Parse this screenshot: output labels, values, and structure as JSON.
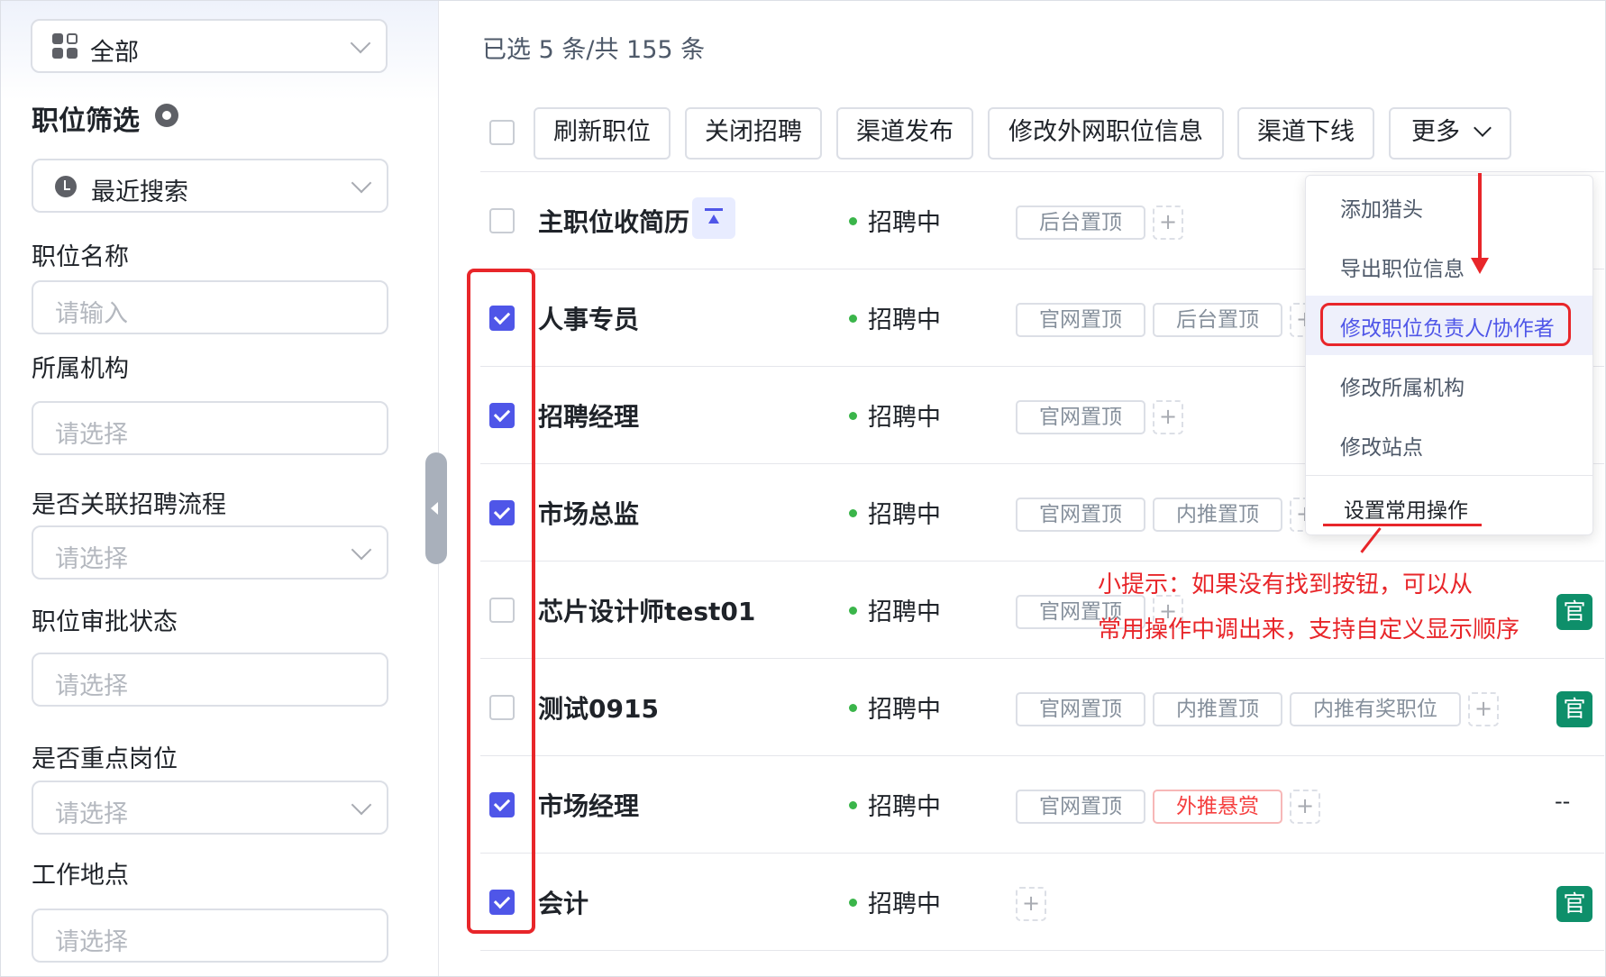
{
  "sidebar": {
    "scope_select": "全部",
    "heading": "职位筛选",
    "recent_search": "最近搜索",
    "filters": [
      {
        "label": "职位名称",
        "placeholder": "请输入"
      },
      {
        "label": "所属机构",
        "placeholder": "请选择"
      },
      {
        "label": "是否关联招聘流程",
        "placeholder": "请选择"
      },
      {
        "label": "职位审批状态",
        "placeholder": "请选择"
      },
      {
        "label": "是否重点岗位",
        "placeholder": "请选择"
      },
      {
        "label": "工作地点",
        "placeholder": "请选择"
      }
    ]
  },
  "main": {
    "selection_count": "已选 5 条/共 155 条",
    "toolbar": [
      "刷新职位",
      "关闭招聘",
      "渠道发布",
      "修改外网职位信息",
      "渠道下线",
      "更多"
    ],
    "rows": [
      {
        "name": "主职位收简历",
        "status": "招聘中",
        "checked": false,
        "tags": [
          "后台置顶"
        ]
      },
      {
        "name": "人事专员",
        "status": "招聘中",
        "checked": true,
        "tags": [
          "官网置顶",
          "后台置顶"
        ]
      },
      {
        "name": "招聘经理",
        "status": "招聘中",
        "checked": true,
        "tags": [
          "官网置顶"
        ]
      },
      {
        "name": "市场总监",
        "status": "招聘中",
        "checked": true,
        "tags": [
          "官网置顶",
          "内推置顶"
        ]
      },
      {
        "name": "芯片设计师test01",
        "status": "招聘中",
        "checked": false,
        "tags": [
          "官网置顶"
        ],
        "badge": "官"
      },
      {
        "name": "测试0915",
        "status": "招聘中",
        "checked": false,
        "tags": [
          "官网置顶",
          "内推置顶",
          "内推有奖职位"
        ],
        "badge": "官"
      },
      {
        "name": "市场经理",
        "status": "招聘中",
        "checked": true,
        "tags": [
          "官网置顶",
          "外推悬赏"
        ],
        "badge": "--"
      },
      {
        "name": "会计",
        "status": "招聘中",
        "checked": true,
        "tags": [],
        "badge": "官"
      }
    ]
  },
  "more_menu": {
    "items": [
      "添加猎头",
      "导出职位信息",
      "修改职位负责人/协作者",
      "修改所属机构",
      "修改站点"
    ],
    "footer": "设置常用操作"
  },
  "annotation": {
    "tip_line1": "小提示：如果没有找到按钮，可以从",
    "tip_line2": "常用操作中调出来，支持自定义显示顺序"
  },
  "colors": {
    "accent": "#4f56e8",
    "status_green": "#3ab54a",
    "annotation_red": "#e8262a",
    "badge_green": "#0e8f6a"
  }
}
